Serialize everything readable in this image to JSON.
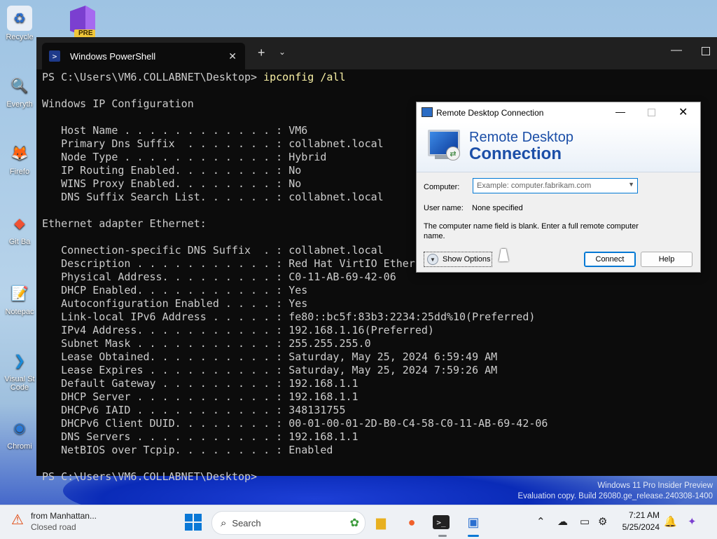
{
  "desktop": {
    "icons": [
      {
        "label": "Recycle",
        "glyph": "♻",
        "bg": "#e8eef6",
        "fg": "#2a6fd0"
      },
      {
        "label": "Everyth",
        "glyph": "🔍",
        "bg": "transparent",
        "fg": "#f27a00"
      },
      {
        "label": "Firefo",
        "glyph": "🦊",
        "bg": "transparent",
        "fg": "#ff6b2a"
      },
      {
        "label": "Git Ba",
        "glyph": "◆",
        "bg": "transparent",
        "fg": "#f05133"
      },
      {
        "label": "Notepac",
        "glyph": "📝",
        "bg": "transparent",
        "fg": "#3c9a3c"
      },
      {
        "label": "Visual St Code",
        "glyph": "❯",
        "bg": "transparent",
        "fg": "#1a8ad8"
      },
      {
        "label": "Chromi",
        "glyph": "◉",
        "bg": "transparent",
        "fg": "#2a7ad8"
      }
    ],
    "pre_badge": "PRE",
    "watermark_line1": "Windows 11 Pro Insider Preview",
    "watermark_line2": "Evaluation copy. Build 26080.ge_release.240308-1400"
  },
  "terminal": {
    "tab_title": "Windows PowerShell",
    "prompt": "PS C:\\Users\\VM6.COLLABNET\\Desktop> ",
    "command": "ipconfig /all",
    "lines": [
      "",
      "Windows IP Configuration",
      "",
      "   Host Name . . . . . . . . . . . . : VM6",
      "   Primary Dns Suffix  . . . . . . . : collabnet.local",
      "   Node Type . . . . . . . . . . . . : Hybrid",
      "   IP Routing Enabled. . . . . . . . : No",
      "   WINS Proxy Enabled. . . . . . . . : No",
      "   DNS Suffix Search List. . . . . . : collabnet.local",
      "",
      "Ethernet adapter Ethernet:",
      "",
      "   Connection-specific DNS Suffix  . : collabnet.local",
      "   Description . . . . . . . . . . . : Red Hat VirtIO Ethernet Adapter",
      "   Physical Address. . . . . . . . . : C0-11-AB-69-42-06",
      "   DHCP Enabled. . . . . . . . . . . : Yes",
      "   Autoconfiguration Enabled . . . . : Yes",
      "   Link-local IPv6 Address . . . . . : fe80::bc5f:83b3:2234:25dd%10(Preferred)",
      "   IPv4 Address. . . . . . . . . . . : 192.168.1.16(Preferred)",
      "   Subnet Mask . . . . . . . . . . . : 255.255.255.0",
      "   Lease Obtained. . . . . . . . . . : Saturday, May 25, 2024 6:59:49 AM",
      "   Lease Expires . . . . . . . . . . : Saturday, May 25, 2024 7:59:26 AM",
      "   Default Gateway . . . . . . . . . : 192.168.1.1",
      "   DHCP Server . . . . . . . . . . . : 192.168.1.1",
      "   DHCPv6 IAID . . . . . . . . . . . : 348131755",
      "   DHCPv6 Client DUID. . . . . . . . : 00-01-00-01-2D-B0-C4-58-C0-11-AB-69-42-06",
      "   DNS Servers . . . . . . . . . . . : 192.168.1.1",
      "   NetBIOS over Tcpip. . . . . . . . : Enabled"
    ],
    "final_prompt": "PS C:\\Users\\VM6.COLLABNET\\Desktop>"
  },
  "rdc": {
    "window_title": "Remote Desktop Connection",
    "banner_line1": "Remote Desktop",
    "banner_line2": "Connection",
    "computer_label": "Computer:",
    "computer_placeholder": "Example: computer.fabrikam.com",
    "username_label": "User name:",
    "username_value": "None specified",
    "info_text": "The computer name field is blank. Enter a full remote computer name.",
    "show_options_label": "Show Options",
    "connect_label": "Connect",
    "help_label": "Help"
  },
  "taskbar": {
    "weather_line1": "from Manhattan...",
    "weather_line2": "Closed road",
    "search_label": "Search",
    "time": "7:21 AM",
    "date": "5/25/2024"
  },
  "colors": {
    "accent": "#0078d4",
    "terminal_bg": "#0c0c0c",
    "terminal_text": "#cccccc",
    "command_text": "#f9f1a5",
    "rdc_banner_text": "#1c4fa8"
  }
}
